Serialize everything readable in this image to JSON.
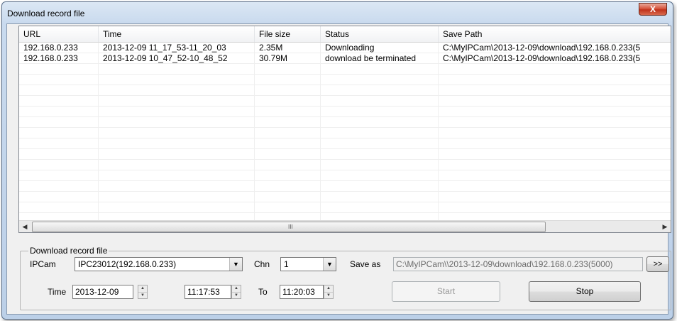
{
  "window": {
    "title": "Download record file",
    "close_glyph": "X"
  },
  "table": {
    "columns": [
      "URL",
      "Time",
      "File size",
      "Status",
      "Save Path"
    ],
    "rows": [
      [
        "192.168.0.233",
        "2013-12-09 11_17_53-11_20_03",
        "2.35M",
        "Downloading",
        "C:\\MyIPCam\\2013-12-09\\download\\192.168.0.233(5"
      ],
      [
        "192.168.0.233",
        "2013-12-09 10_47_52-10_48_52",
        "30.79M",
        "download be terminated",
        "C:\\MyIPCam\\2013-12-09\\download\\192.168.0.233(5"
      ]
    ],
    "scroll_left_icon": "triangle-left",
    "scroll_right_icon": "triangle-right",
    "scroll_grip": "III"
  },
  "form": {
    "group_title": "Download record file",
    "ipcam_label": "IPCam",
    "ipcam_value": "IPC23012(192.168.0.233)",
    "chn_label": "Chn",
    "chn_value": "1",
    "save_as_label": "Save as",
    "save_as_value": "C:\\MyIPCam\\\\2013-12-09\\download\\192.168.0.233(5000)",
    "browse_label": ">>",
    "time_label": "Time",
    "date_value": "2013-12-09",
    "from_time_value": "11:17:53",
    "to_label": "To",
    "to_time_value": "11:20:03",
    "start_label": "Start",
    "stop_label": "Stop"
  }
}
